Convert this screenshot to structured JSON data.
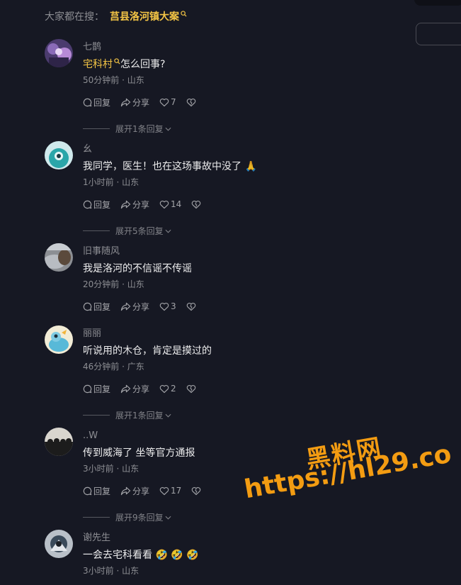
{
  "search_suggest": {
    "prefix": "大家都在搜：",
    "keyword": "莒县洛河镇大案"
  },
  "actions_labels": {
    "reply": "回复",
    "share": "分享"
  },
  "comments": [
    {
      "username": "七鹊",
      "mention": "宅科村",
      "text": "怎么回事?",
      "meta": "50分钟前 · 山东",
      "likes": "7",
      "expand": "展开1条回复"
    },
    {
      "username": "幺",
      "mention": "",
      "text": "我同学，医生！也在这场事故中没了 🙏",
      "meta": "1小时前 · 山东",
      "likes": "14",
      "expand": "展开5条回复"
    },
    {
      "username": "旧事随风",
      "mention": "",
      "text": "我是洛河的不信谣不传谣",
      "meta": "20分钟前 · 山东",
      "likes": "3",
      "expand": ""
    },
    {
      "username": "丽丽",
      "mention": "",
      "text": "听说用的木仓，肯定是摸过的",
      "meta": "46分钟前 · 广东",
      "likes": "2",
      "expand": "展开1条回复"
    },
    {
      "username": "..W",
      "mention": "",
      "text": "传到威海了 坐等官方通报",
      "meta": "3小时前 · 山东",
      "likes": "17",
      "expand": "展开9条回复"
    },
    {
      "username": "谢先生",
      "mention": "",
      "text": "一会去宅科看看 🤣 🤣 🤣",
      "meta": "3小时前 · 山东",
      "likes": "",
      "expand": ""
    }
  ],
  "watermark": {
    "title": "黑料网",
    "url": "https://hl29.co"
  },
  "colors": {
    "background": "#161823",
    "highlight": "#f4c545",
    "watermark": "#f39c12"
  }
}
